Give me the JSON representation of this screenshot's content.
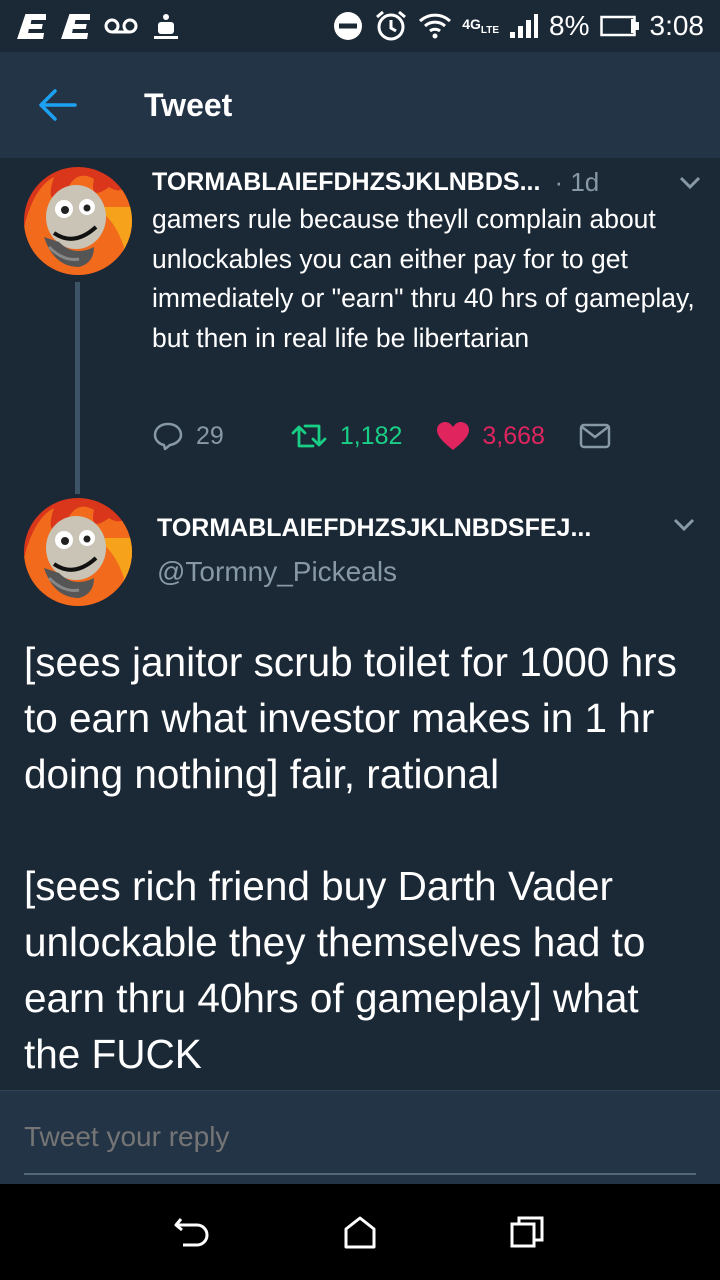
{
  "status_bar": {
    "network": "4G",
    "network_sub": "LTE",
    "battery": "8%",
    "time": "3:08",
    "icons": [
      "notification-e-icon",
      "notification-e-icon",
      "voicemail-icon",
      "android-notification-icon",
      "dnd-icon",
      "alarm-icon",
      "wifi-icon",
      "signal-icon",
      "battery-icon"
    ]
  },
  "app_bar": {
    "title": "Tweet",
    "back_icon": "arrow-left-icon"
  },
  "parent_tweet": {
    "display_name": "TORMABLAIEFDHZSJKLNBDS...",
    "time": "· 1d",
    "text": "gamers rule because theyll complain about unlockables you can either pay for to get immediately or \"earn\" thru 40 hrs of gameplay, but then in real life be libertarian",
    "actions": {
      "replies": "29",
      "retweets": "1,182",
      "likes": "3,668"
    }
  },
  "main_tweet": {
    "display_name": "TORMABLAIEFDHZSJKLNBDSFEJ...",
    "handle": "@Tormny_Pickeals",
    "text": "[sees janitor scrub toilet for 1000 hrs to earn what investor makes in 1 hr doing nothing] fair, rational\n\n[sees rich friend buy Darth Vader unlockable they themselves had to earn thru 40hrs of gameplay] what the FUCK"
  },
  "reply_box": {
    "placeholder": "Tweet your reply"
  },
  "colors": {
    "background": "#1b2836",
    "app_bar": "#243447",
    "accent_blue": "#1da1f2",
    "retweet_green": "#19cf86",
    "like_red": "#e0245e",
    "secondary_text": "#8899a6"
  }
}
